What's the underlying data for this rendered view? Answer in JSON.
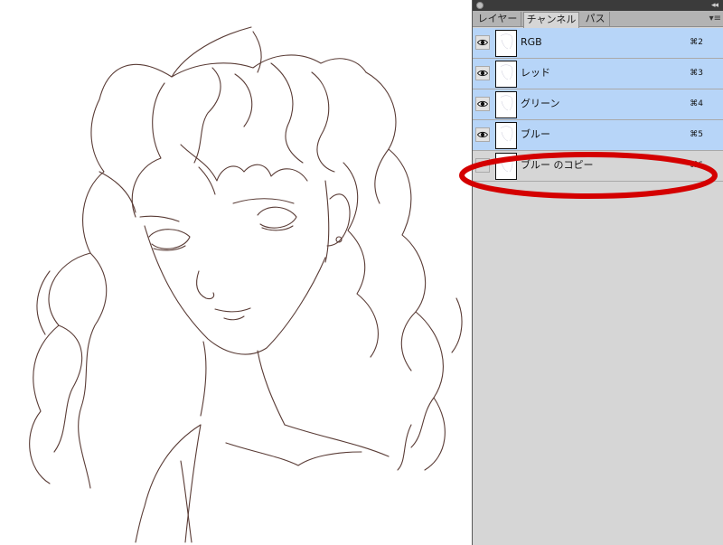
{
  "panel": {
    "menu_icon": "panel-menu-icon",
    "tabs": [
      {
        "label": "レイヤー",
        "active": false
      },
      {
        "label": "チャンネル",
        "active": true
      },
      {
        "label": "パス",
        "active": false
      }
    ]
  },
  "channels": [
    {
      "label": "RGB",
      "shortcut": "⌘2",
      "visible": true,
      "selected": true
    },
    {
      "label": "レッド",
      "shortcut": "⌘3",
      "visible": true,
      "selected": true
    },
    {
      "label": "グリーン",
      "shortcut": "⌘4",
      "visible": true,
      "selected": true
    },
    {
      "label": "ブルー",
      "shortcut": "⌘5",
      "visible": true,
      "selected": true
    },
    {
      "label": "ブルー のコピー",
      "shortcut": "⌘6",
      "visible": false,
      "selected": false
    }
  ],
  "colors": {
    "selected_row": "#b7d5f8",
    "annotation": "#d40000",
    "sketch_line": "#5a3c36"
  }
}
